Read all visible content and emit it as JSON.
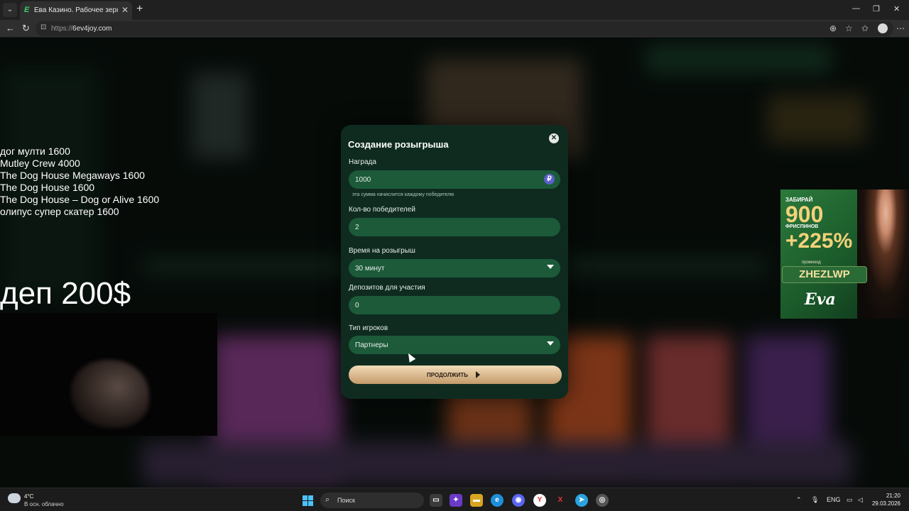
{
  "browser": {
    "tab_title": "Ева Казино. Рабочее зеркало. О",
    "url_scheme": "https://",
    "url_host": "6ev4joy.com"
  },
  "overlay": {
    "slots": [
      "дог мулти 1600",
      "Mutley Crew 4000",
      "The Dog House Megaways 1600",
      "The Dog House 1600",
      "The Dog House – Dog or Alive 1600",
      "олипус супер скатер 1600"
    ],
    "deposit": "деп 200$"
  },
  "modal": {
    "title": "Создание розыгрыша",
    "reward_label": "Награда",
    "reward_value": "1000",
    "reward_currency_icon": "₽",
    "reward_hint": "эта сумма начислится каждому победителю",
    "winners_label": "Кол-во победителей",
    "winners_value": "2",
    "duration_label": "Время на розыгрыш",
    "duration_value": "30 минут",
    "deposits_label": "Депозитов для участия",
    "deposits_value": "0",
    "player_type_label": "Тип игроков",
    "player_type_value": "Партнеры",
    "continue_label": "ПРОДОЛЖИТЬ"
  },
  "ad": {
    "line1": "ЗАБИРАЙ",
    "line2": "900",
    "line3": "ФРИСПИНОВ",
    "line4": "+225%",
    "line5": "промокод",
    "promo_code": "ZHEZLWP",
    "logo": "Eva"
  },
  "taskbar": {
    "temperature": "4°C",
    "condition": "В осн. облачно",
    "search_placeholder": "Поиск",
    "language": "ENG",
    "time": "21:20",
    "date": "29.03.2026"
  },
  "colors": {
    "modal_bg": "#0f2b20",
    "field_bg": "#1c5a3a",
    "button_gold": "#d9b98e",
    "ad_green": "#2c7a3c"
  }
}
